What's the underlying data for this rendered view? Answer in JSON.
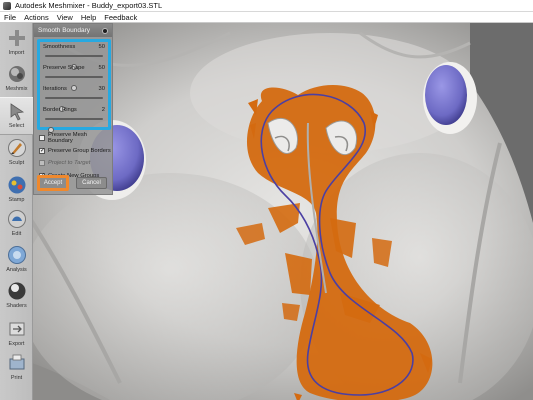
{
  "window": {
    "title": "Autodesk Meshmixer - Buddy_export03.STL"
  },
  "menu": [
    "File",
    "Actions",
    "View",
    "Help",
    "Feedback"
  ],
  "toolbar": [
    {
      "label": "Import",
      "icon": "plus-icon"
    },
    {
      "label": "Meshmix",
      "icon": "meshmix-icon"
    },
    {
      "label": "Select",
      "icon": "select-arrow-icon"
    },
    {
      "label": "Sculpt",
      "icon": "sculpt-brush-icon"
    },
    {
      "label": "Stamp",
      "icon": "stamp-icon"
    },
    {
      "label": "Edit",
      "icon": "edit-icon"
    },
    {
      "label": "Analysis",
      "icon": "analysis-icon"
    },
    {
      "label": "Shaders",
      "icon": "shaders-icon"
    },
    {
      "label": "Export",
      "icon": "export-icon"
    },
    {
      "label": "Print",
      "icon": "print-icon"
    }
  ],
  "active_tool": "Select",
  "panel": {
    "title": "Smooth Boundary",
    "sliders": [
      {
        "label": "Smoothness",
        "value": "50",
        "fraction": 0.5
      },
      {
        "label": "Preserve Shape",
        "value": "50",
        "fraction": 0.5
      },
      {
        "label": "Iterations",
        "value": "30",
        "fraction": 0.3
      },
      {
        "label": "Border Rings",
        "value": "2",
        "fraction": 0.1
      }
    ],
    "checkboxes": [
      {
        "label": "Preserve Mesh Boundary",
        "checked": false,
        "disabled": false
      },
      {
        "label": "Preserve Group Borders",
        "checked": true,
        "disabled": false
      },
      {
        "label": "Project to Target",
        "checked": false,
        "disabled": true
      },
      {
        "label": "Create New Groups",
        "checked": true,
        "disabled": false
      }
    ],
    "accept_label": "Accept",
    "cancel_label": "Cancel"
  },
  "colors": {
    "highlight_blue": "#27a9e1",
    "highlight_orange": "#f0892d",
    "selection_orange": "#d46a10",
    "boundary_purple": "#4b3fa3",
    "eye_purple": "#6d6ac4"
  }
}
